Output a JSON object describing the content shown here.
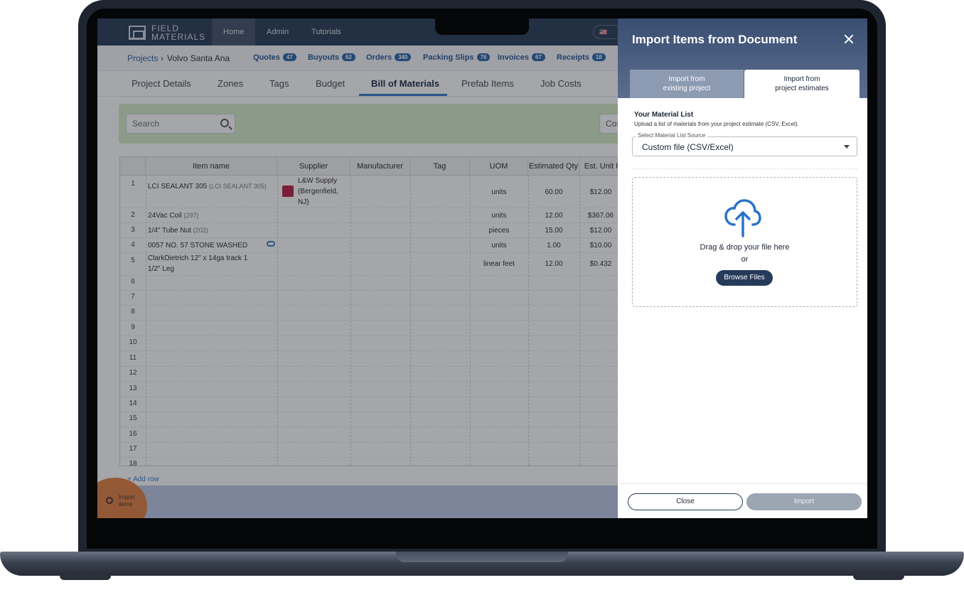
{
  "nav": {
    "logo_line1": "FIELD",
    "logo_line2": "MATERIALS",
    "items": [
      "Home",
      "Admin",
      "Tutorials"
    ]
  },
  "breadcrumb": {
    "projects": "Projects",
    "separator": "›",
    "current": "Volvo Santa Ana",
    "links": [
      {
        "label": "Quotes",
        "count": "47"
      },
      {
        "label": "Buyouts",
        "count": "62"
      },
      {
        "label": "Orders",
        "count": "340"
      },
      {
        "label": "Packing Slips",
        "count": "76"
      },
      {
        "label": "Invoices",
        "count": "67"
      },
      {
        "label": "Receipts",
        "count": "18"
      }
    ]
  },
  "tabs": [
    "Project Details",
    "Zones",
    "Tags",
    "Budget",
    "Bill of Materials",
    "Prefab Items",
    "Job Costs"
  ],
  "toolbar": {
    "search_placeholder": "Search",
    "cost_label": "Cos"
  },
  "table": {
    "headers": [
      "Item name",
      "Supplier",
      "Manufacturer",
      "Tag",
      "UOM",
      "Estimated Qty",
      "Est. Unit Pr"
    ],
    "rows": [
      {
        "num": "1",
        "name": "LCI SEALANT 305",
        "code": "(LCI SEALANT 305)",
        "supplier": "L&W Supply (Bergenfield, NJ)",
        "uom": "units",
        "qty": "60.00",
        "price": "$12.00"
      },
      {
        "num": "2",
        "name": "24Vac Coil",
        "code": "(297)",
        "supplier": "",
        "uom": "units",
        "qty": "12.00",
        "price": "$367.06"
      },
      {
        "num": "3",
        "name": "1/4\" Tube Nut",
        "code": "(202)",
        "supplier": "",
        "uom": "pieces",
        "qty": "15.00",
        "price": "$12.00"
      },
      {
        "num": "4",
        "name": "0057 NO. 57 STONE WASHED",
        "code": "",
        "supplier": "",
        "uom": "units",
        "qty": "1.00",
        "price": "$10.00"
      },
      {
        "num": "5",
        "name": "ClarkDietrich 12\" x 14ga track 1 1/2\" Leg",
        "code": "",
        "supplier": "",
        "uom": "linear feet",
        "qty": "12.00",
        "price": "$0.432"
      }
    ],
    "empty_rows": [
      "6",
      "7",
      "8",
      "9",
      "10",
      "11",
      "12",
      "13",
      "14",
      "15",
      "16",
      "17",
      "18"
    ],
    "add_row": "+ Add row"
  },
  "fab": {
    "label_line1": "Import",
    "label_line2": "items"
  },
  "panel": {
    "title": "Import Items from Document",
    "tab_inactive_line1": "Import from",
    "tab_inactive_line2": "existing project",
    "tab_active_line1": "Import from",
    "tab_active_line2": "project estimates",
    "section_title": "Your Material List",
    "section_desc": "Upload a list of materials from your project estimate (CSV, Excel).",
    "select_label": "Select Material List Source",
    "select_value": "Custom file (CSV/Excel)",
    "drop_text": "Drag & drop your file here",
    "or_text": "or",
    "browse_label": "Browse Files",
    "close_label": "Close",
    "import_label": "Import"
  },
  "colors": {
    "nav_bg": "#20324f",
    "accent_blue": "#2a74c7",
    "toolbar_green": "#d3ecc4",
    "fab_orange": "#e07a3c",
    "panel_header": "#394e72",
    "button_dark": "#263a5a",
    "button_disabled": "#9ca6b3"
  }
}
